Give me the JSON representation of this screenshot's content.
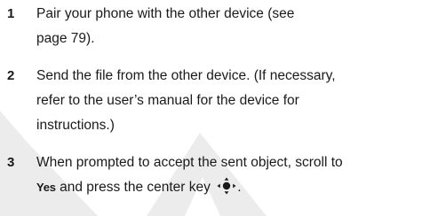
{
  "steps": [
    {
      "number": "1",
      "lines": [
        "Pair your phone with the other device (see",
        "page 79)."
      ]
    },
    {
      "number": "2",
      "lines": [
        "Send the file from the other device. (If necessary,",
        "refer to the user’s manual for the device for",
        "instructions.)"
      ]
    },
    {
      "number": "3",
      "line1": "When prompted to accept the sent object, scroll to",
      "bold_word": "Yes",
      "after_bold": " and press the center key",
      "after_icon": "."
    }
  ],
  "icons": {
    "center_key": "nav-center-key-icon"
  },
  "colors": {
    "text": "#1a1a1a",
    "watermark": "#e6e6e6"
  }
}
